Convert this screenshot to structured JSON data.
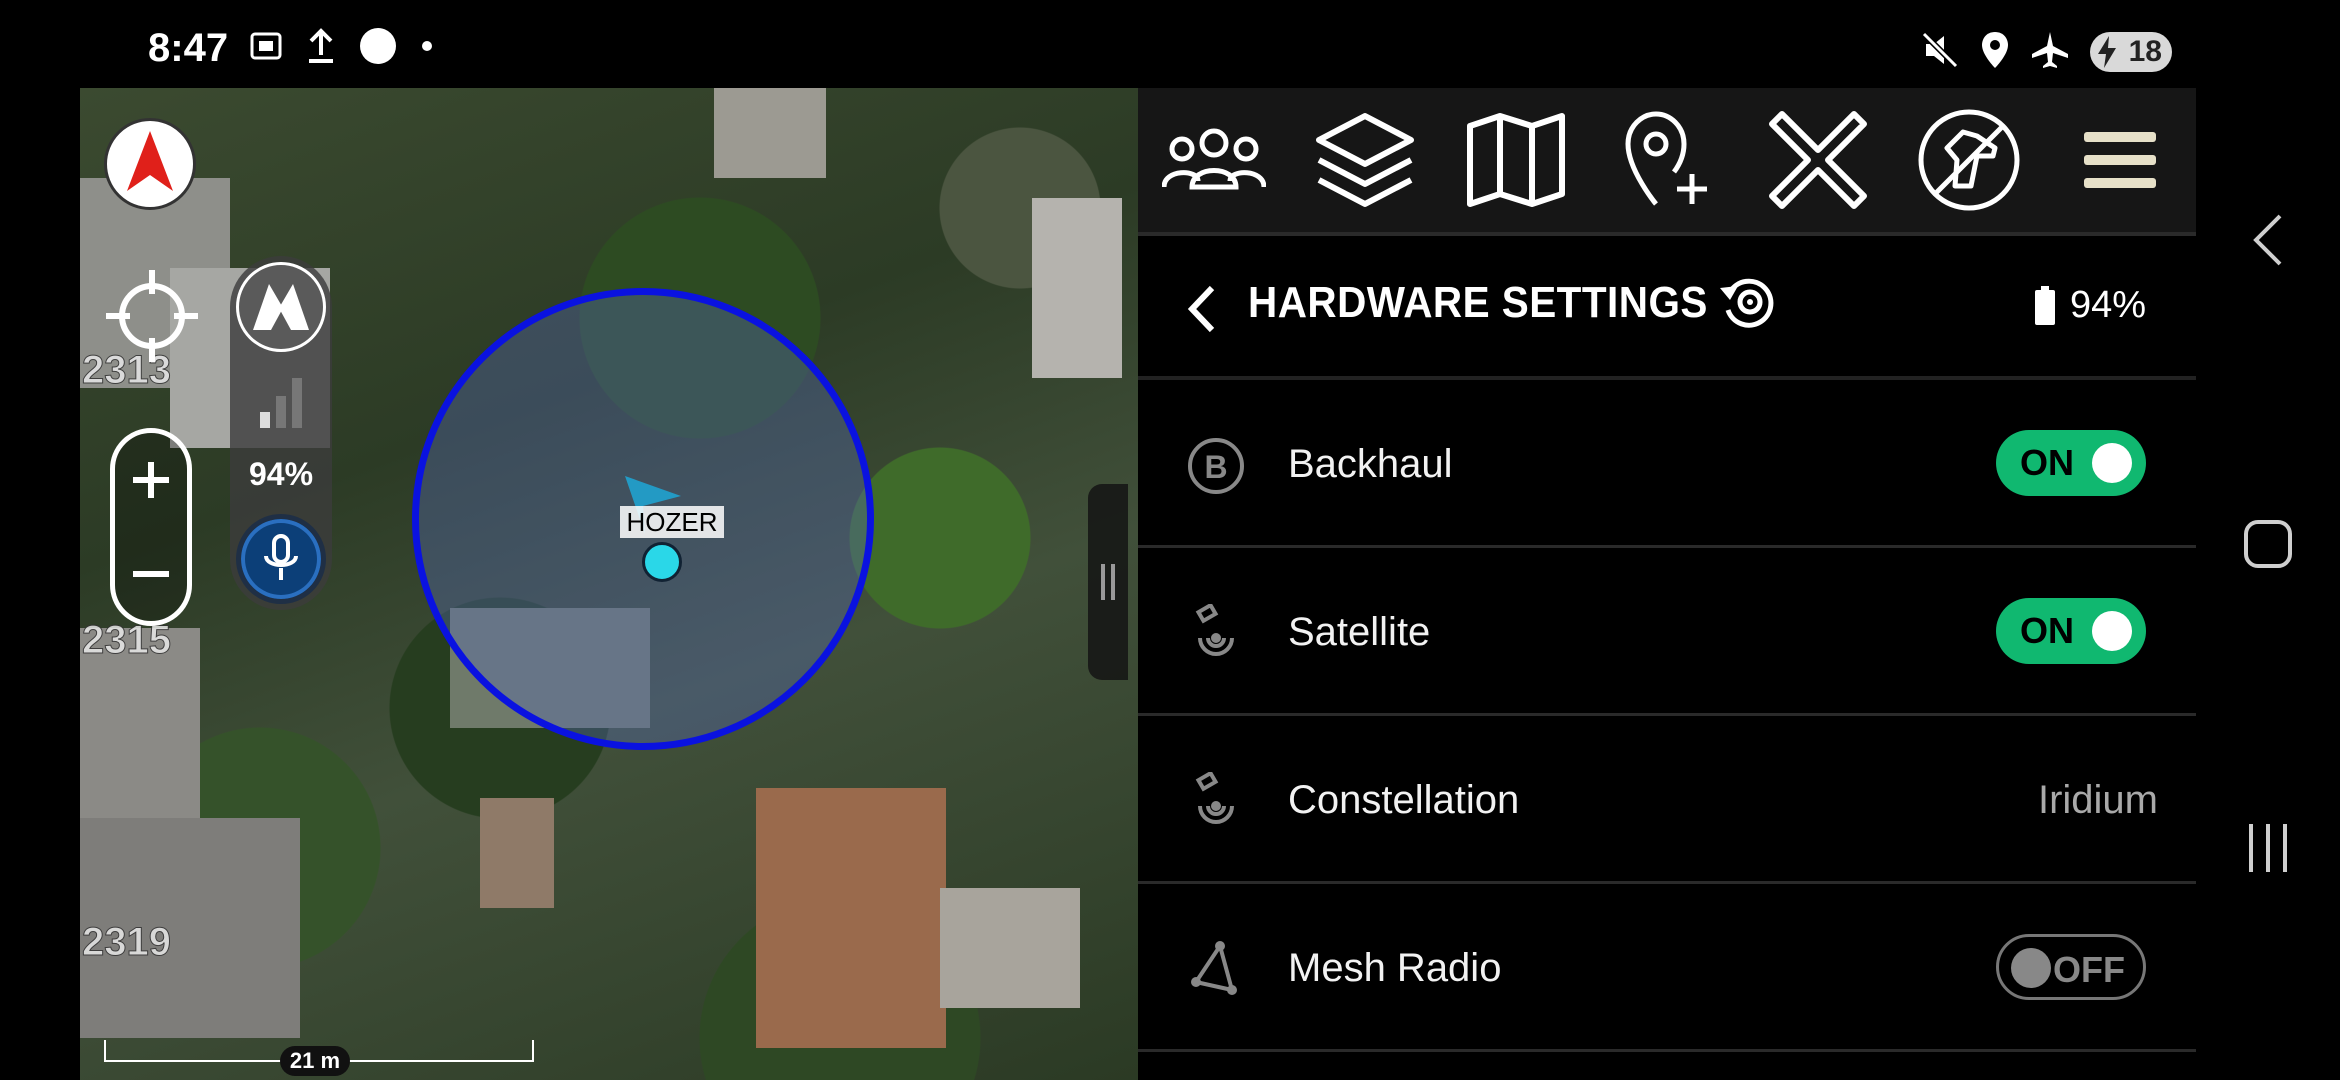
{
  "status_bar": {
    "time": "8:47",
    "left_icons": [
      "screenshot-icon",
      "upload-icon",
      "circle-icon",
      "dot-icon"
    ],
    "right_icons": [
      "mute-icon",
      "location-icon",
      "airplane-icon"
    ],
    "battery": "18"
  },
  "map": {
    "lot_numbers": [
      "2313",
      "2315",
      "2319"
    ],
    "user_label": "HOZER",
    "radio_signal_percent": "94%",
    "scale_label": "21 m",
    "geofence_color": "#0a12e0",
    "user_dot_color": "#2ad7e8",
    "compass_color": "#e0201a"
  },
  "toolbar": {
    "buttons": [
      "team-icon",
      "layers-icon",
      "map-icon",
      "add-pin-icon",
      "close-icon",
      "k9-icon",
      "menu-icon"
    ]
  },
  "header": {
    "title": "HARDWARE SETTINGS",
    "battery": "94%"
  },
  "settings": [
    {
      "label": "Backhaul",
      "icon": "backhaul-icon",
      "type": "toggle",
      "state": "ON"
    },
    {
      "label": "Satellite",
      "icon": "satellite-icon",
      "type": "toggle",
      "state": "ON"
    },
    {
      "label": "Constellation",
      "icon": "satellite-icon",
      "type": "value",
      "value": "Iridium"
    },
    {
      "label": "Mesh Radio",
      "icon": "mesh-radio-icon",
      "type": "toggle",
      "state": "OFF"
    }
  ],
  "colors": {
    "toggle_on": "#10b870",
    "toolbar_bg": "#161616",
    "accent_menu": "#e6e0c8"
  }
}
